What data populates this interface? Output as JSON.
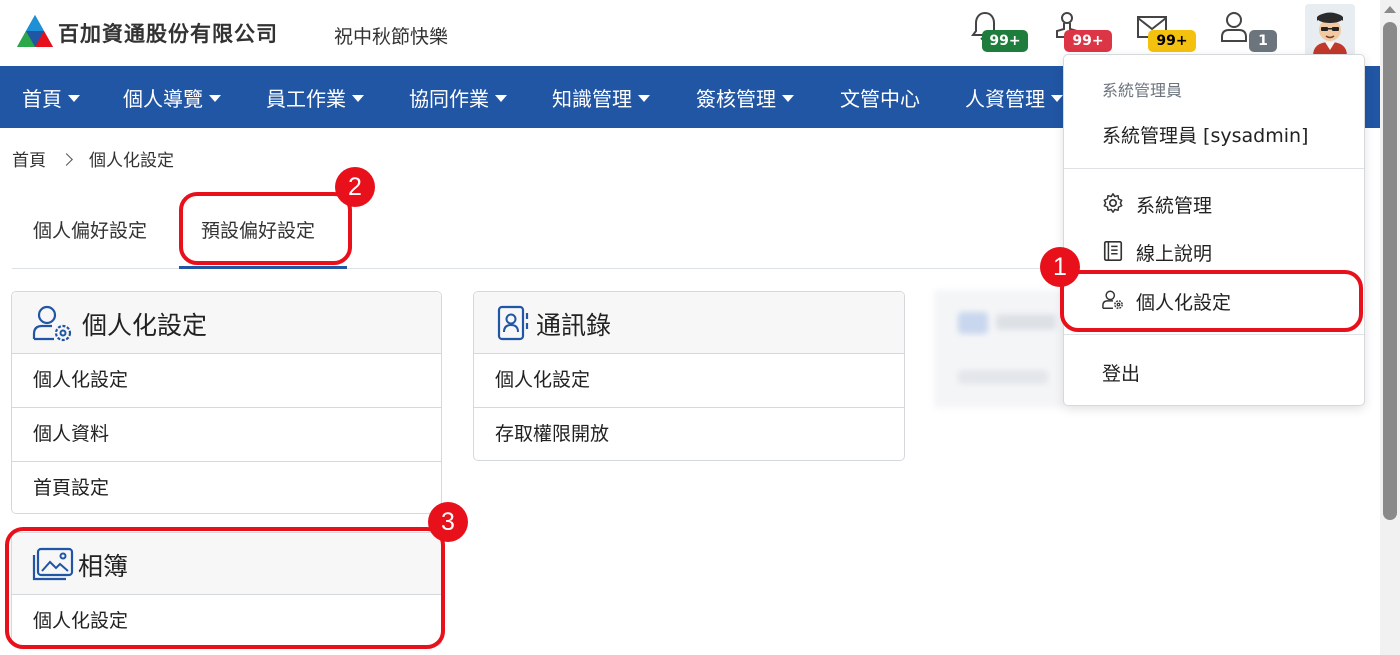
{
  "header": {
    "company_name": "百加資通股份有限公司",
    "greeting": "祝中秋節快樂",
    "badges": {
      "notifications": "99+",
      "approvals": "99+",
      "mail": "99+",
      "users": "1"
    }
  },
  "colors": {
    "nav_bg": "#2156a5",
    "badge_green": "#1e7d3c",
    "badge_red": "#dc3545",
    "badge_yellow": "#f4c10f",
    "badge_grey": "#6c757d",
    "annotation_red": "#e8101a"
  },
  "nav": {
    "items": [
      {
        "label": "首頁",
        "dropdown": true
      },
      {
        "label": "個人導覽",
        "dropdown": true
      },
      {
        "label": "員工作業",
        "dropdown": true
      },
      {
        "label": "協同作業",
        "dropdown": true
      },
      {
        "label": "知識管理",
        "dropdown": true
      },
      {
        "label": "簽核管理",
        "dropdown": true
      },
      {
        "label": "文管中心",
        "dropdown": false
      },
      {
        "label": "人資管理",
        "dropdown": true
      }
    ]
  },
  "breadcrumb": {
    "home": "首頁",
    "current": "個人化設定"
  },
  "tabs": [
    {
      "label": "個人偏好設定",
      "active": false
    },
    {
      "label": "預設偏好設定",
      "active": true
    }
  ],
  "cards": {
    "personalization": {
      "title": "個人化設定",
      "icon": "user-gear-icon",
      "rows": [
        "個人化設定",
        "個人資料",
        "首頁設定"
      ]
    },
    "contacts": {
      "title": "通訊錄",
      "icon": "contact-book-icon",
      "rows": [
        "個人化設定",
        "存取權限開放"
      ]
    },
    "album": {
      "title": "相簿",
      "icon": "photo-album-icon",
      "rows": [
        "個人化設定"
      ]
    }
  },
  "user_menu": {
    "role_header": "系統管理員",
    "user_display": "系統管理員 [sysadmin]",
    "items": [
      {
        "label": "系統管理",
        "icon": "gear-icon"
      },
      {
        "label": "線上說明",
        "icon": "book-icon"
      },
      {
        "label": "個人化設定",
        "icon": "user-gear-icon"
      }
    ],
    "logout": "登出"
  },
  "annotations": [
    "1",
    "2",
    "3"
  ]
}
